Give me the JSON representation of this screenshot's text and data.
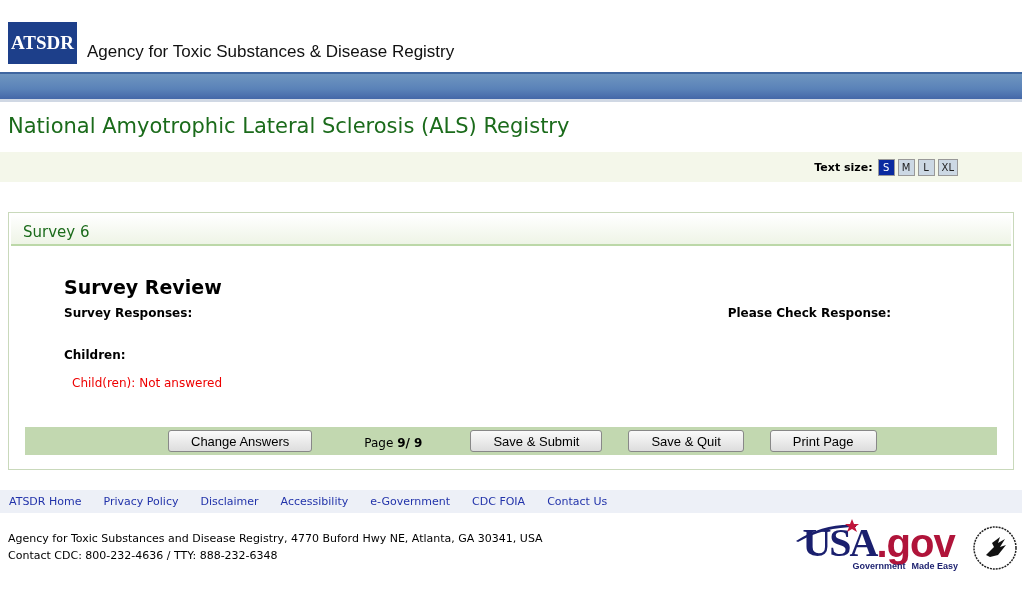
{
  "header": {
    "logo": "ATSDR",
    "agency": "Agency for Toxic Substances & Disease Registry"
  },
  "page_title": "National Amyotrophic Lateral Sclerosis (ALS) Registry",
  "text_size": {
    "label": "Text size:",
    "options": [
      {
        "label": "S",
        "selected": true
      },
      {
        "label": "M",
        "selected": false
      },
      {
        "label": "L",
        "selected": false
      },
      {
        "label": "XL",
        "selected": false
      }
    ]
  },
  "card": {
    "title": "Survey 6",
    "heading": "Survey Review",
    "responses_label": "Survey Responses:",
    "check_label": "Please Check Response:",
    "section": "Children:",
    "answer": "Child(ren): Not answered"
  },
  "actions": [
    {
      "kind": "button",
      "label": "Change Answers"
    },
    {
      "kind": "pager",
      "label": "Page",
      "value": "9/ 9"
    },
    {
      "kind": "button",
      "label": "Save & Submit"
    },
    {
      "kind": "button",
      "label": "Save & Quit"
    },
    {
      "kind": "button",
      "label": "Print Page"
    }
  ],
  "footer": {
    "links": [
      "ATSDR Home",
      "Privacy Policy",
      "Disclaimer",
      "Accessibility",
      "e-Government",
      "CDC FOIA",
      "Contact Us"
    ],
    "address": "Agency for Toxic Substances and Disease Registry, 4770 Buford Hwy NE, Atlanta, GA 30341, USA",
    "contact": "Contact CDC: 800-232-4636 / TTY: 888-232-6348",
    "usa_logo": {
      "main": "USA",
      "suffix": ".gov",
      "tagline_left": "Government",
      "tagline_right": "Made Easy"
    }
  }
}
